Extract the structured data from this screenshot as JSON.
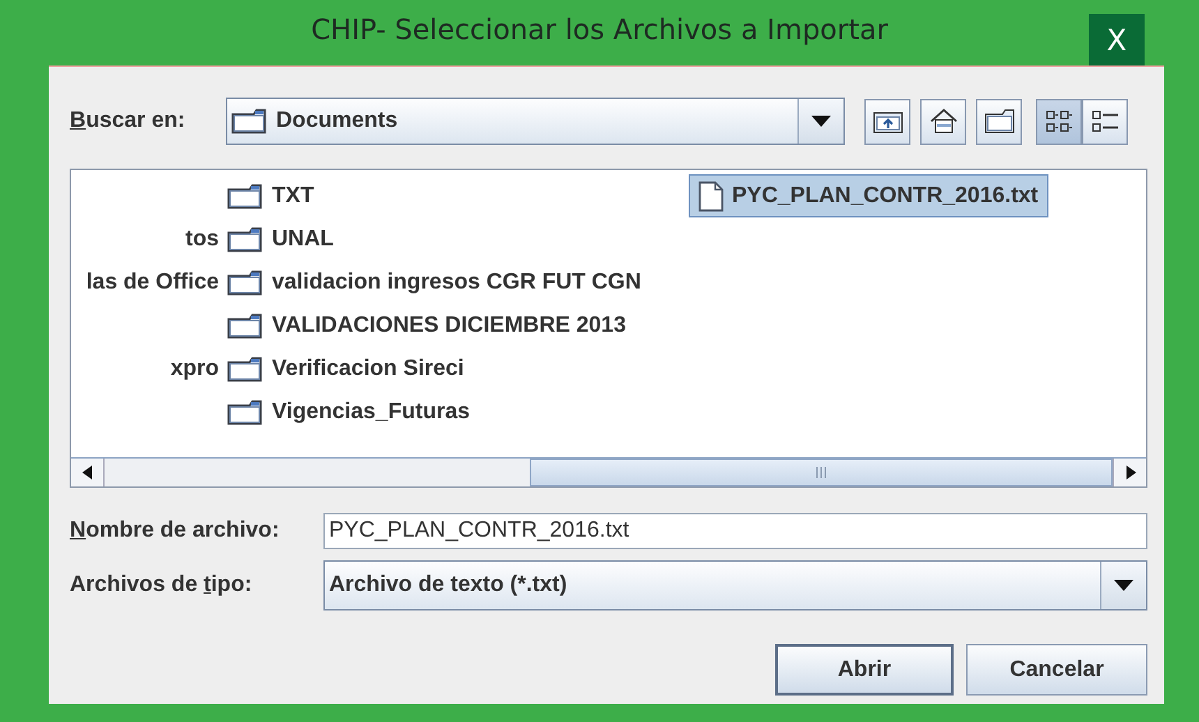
{
  "window": {
    "title": "CHIP- Seleccionar los Archivos a Importar",
    "close_label": "X"
  },
  "look_in": {
    "label": [
      {
        "text": "B",
        "underlined": true
      },
      {
        "text": "uscar en:",
        "underlined": false
      }
    ],
    "value": "Documents"
  },
  "view_toggles": [
    {
      "kind": "list",
      "selected": true
    },
    {
      "kind": "details",
      "selected": false
    }
  ],
  "files": {
    "columns": [
      {
        "items": [
          {
            "kind": "blank"
          },
          {
            "kind": "cut",
            "name": "tos",
            "selected": false
          },
          {
            "kind": "cut",
            "name": "las de Office",
            "selected": false
          },
          {
            "kind": "blank"
          },
          {
            "kind": "cut",
            "name": "xpro",
            "selected": false
          },
          {
            "kind": "blank"
          }
        ]
      },
      {
        "items": [
          {
            "kind": "folder",
            "name": "TXT",
            "selected": false
          },
          {
            "kind": "folder",
            "name": "UNAL",
            "selected": false
          },
          {
            "kind": "folder",
            "name": "validacion ingresos CGR FUT CGN",
            "selected": false
          },
          {
            "kind": "folder",
            "name": "VALIDACIONES DICIEMBRE 2013",
            "selected": false
          },
          {
            "kind": "folder",
            "name": "Verificacion Sireci",
            "selected": false
          },
          {
            "kind": "folder",
            "name": "Vigencias_Futuras",
            "selected": false
          }
        ]
      },
      {
        "items": [
          {
            "kind": "file",
            "name": "PYC_PLAN_CONTR_2016.txt",
            "selected": true
          }
        ]
      }
    ]
  },
  "file_name": {
    "label": [
      {
        "text": "N",
        "underlined": true
      },
      {
        "text": "ombre de archivo:",
        "underlined": false
      }
    ],
    "value": "PYC_PLAN_CONTR_2016.txt"
  },
  "file_type": {
    "label": [
      {
        "text": "Archivos de ",
        "underlined": false
      },
      {
        "text": "t",
        "underlined": true
      },
      {
        "text": "ipo:",
        "underlined": false
      }
    ],
    "value": "Archivo de texto (*.txt)"
  },
  "buttons": [
    {
      "label": "Abrir",
      "default": true
    },
    {
      "label": "Cancelar",
      "default": false
    }
  ]
}
